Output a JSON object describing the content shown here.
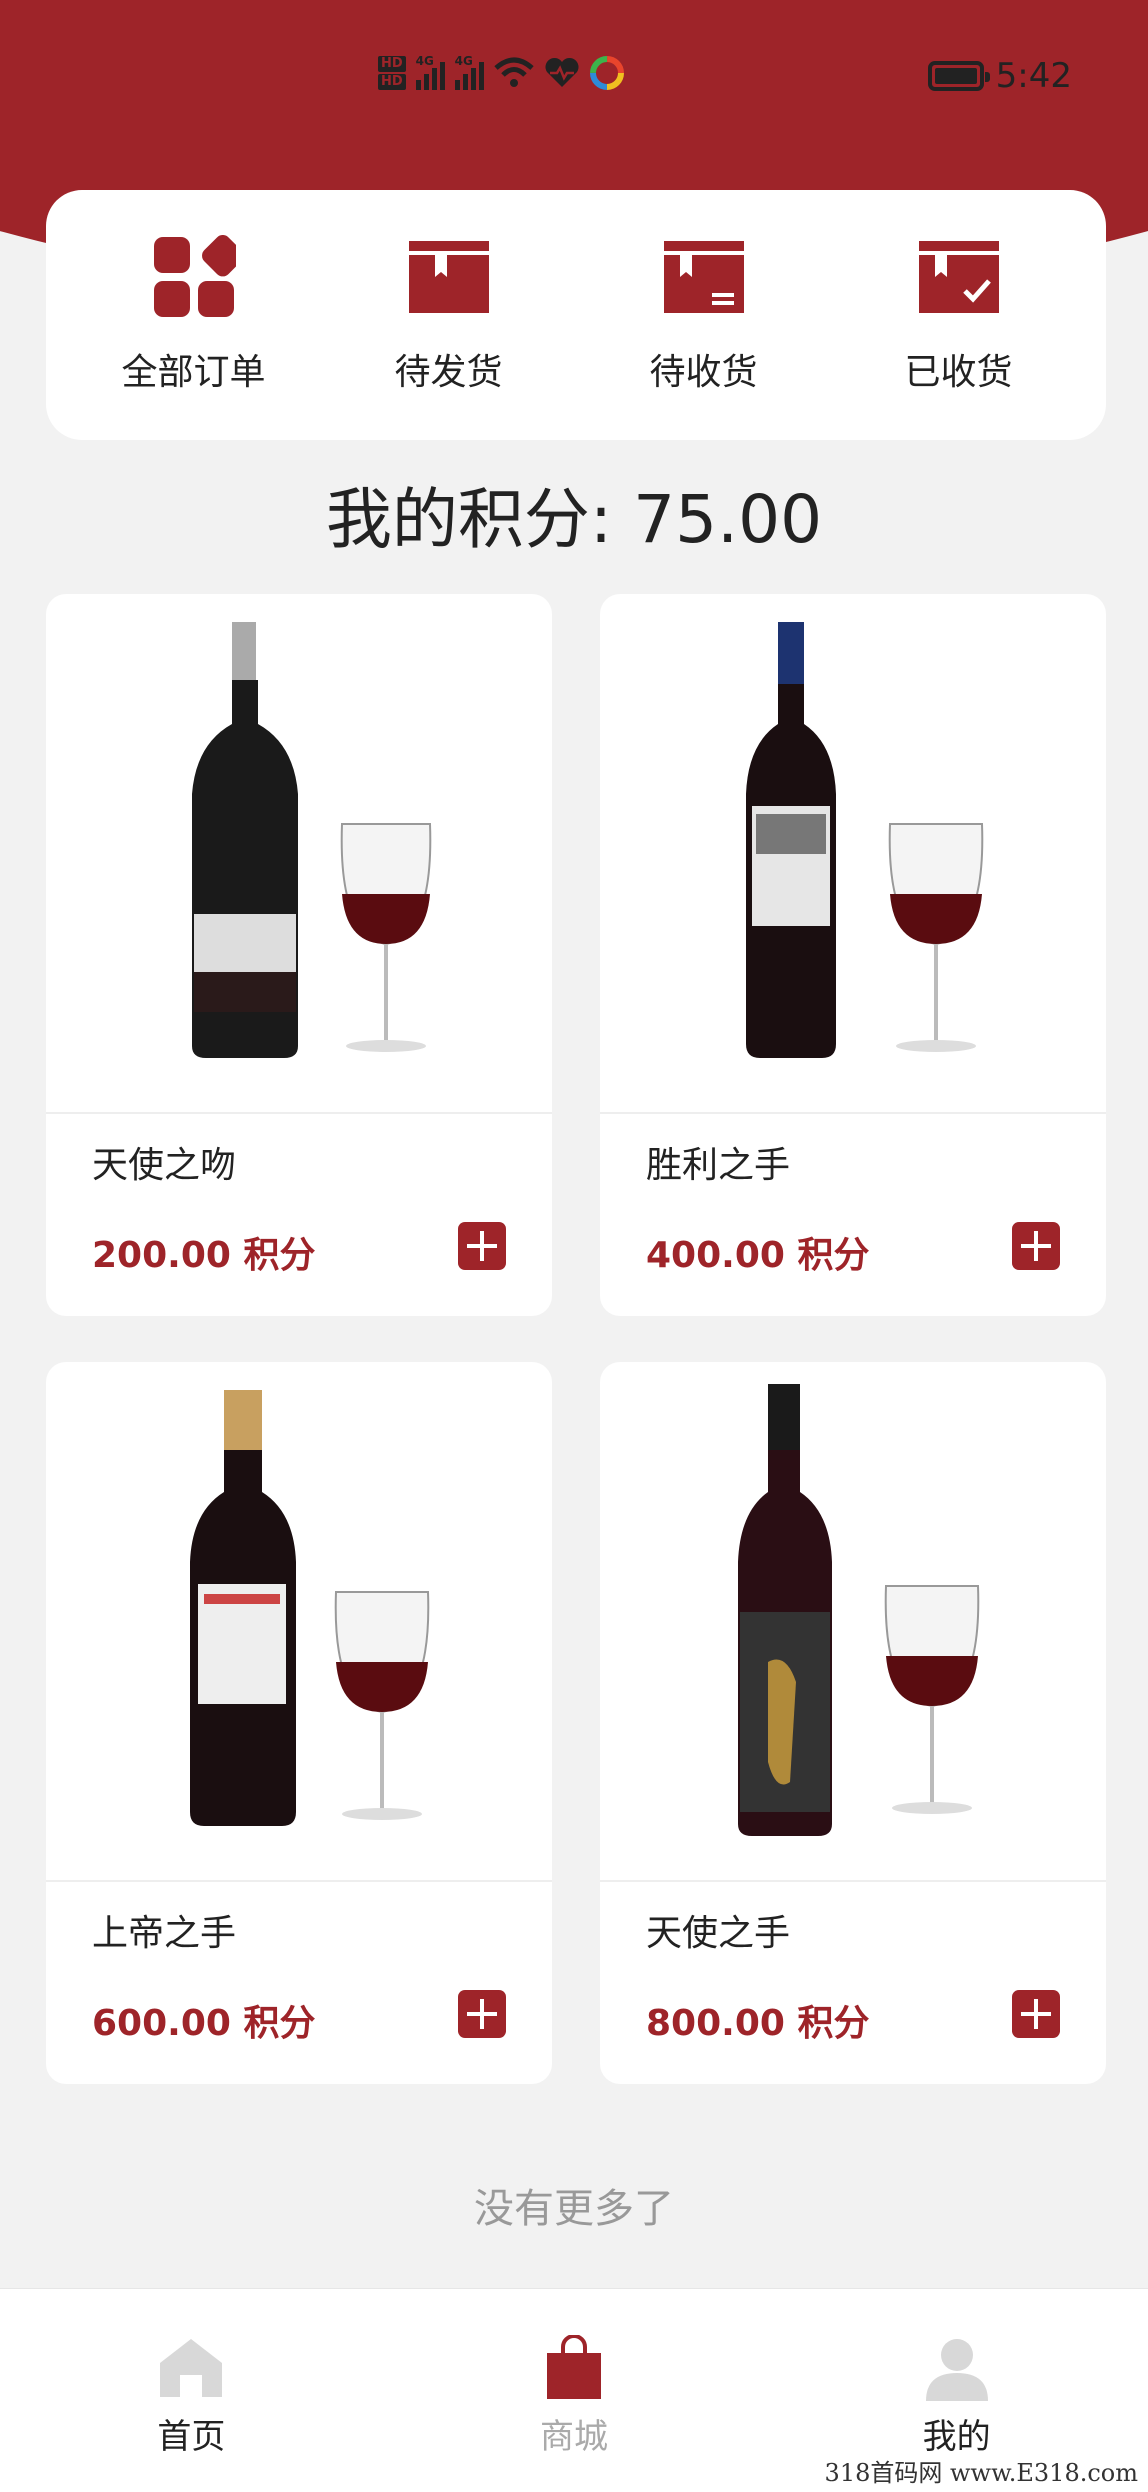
{
  "status_bar": {
    "time": "5:42",
    "network": "4G"
  },
  "orders": [
    {
      "label": "全部订单",
      "icon": "grid-icon"
    },
    {
      "label": "待发货",
      "icon": "box-icon"
    },
    {
      "label": "待收货",
      "icon": "box-receive-icon"
    },
    {
      "label": "已收货",
      "icon": "box-check-icon"
    }
  ],
  "points": {
    "label": "我的积分: 75.00"
  },
  "products": [
    {
      "name": "天使之吻",
      "price": "200.00 积分"
    },
    {
      "name": "胜利之手",
      "price": "400.00 积分"
    },
    {
      "name": "上帝之手",
      "price": "600.00 积分"
    },
    {
      "name": "天使之手",
      "price": "800.00 积分"
    }
  ],
  "footer": {
    "no_more": "没有更多了"
  },
  "tabs": [
    {
      "label": "首页",
      "icon": "home-icon"
    },
    {
      "label": "商城",
      "icon": "shopping-bag-icon",
      "active": true
    },
    {
      "label": "我的",
      "icon": "user-icon"
    }
  ],
  "watermark": "318首码网 www.E318.com",
  "colors": {
    "primary": "#9e2429",
    "background": "#f2f2f2"
  }
}
